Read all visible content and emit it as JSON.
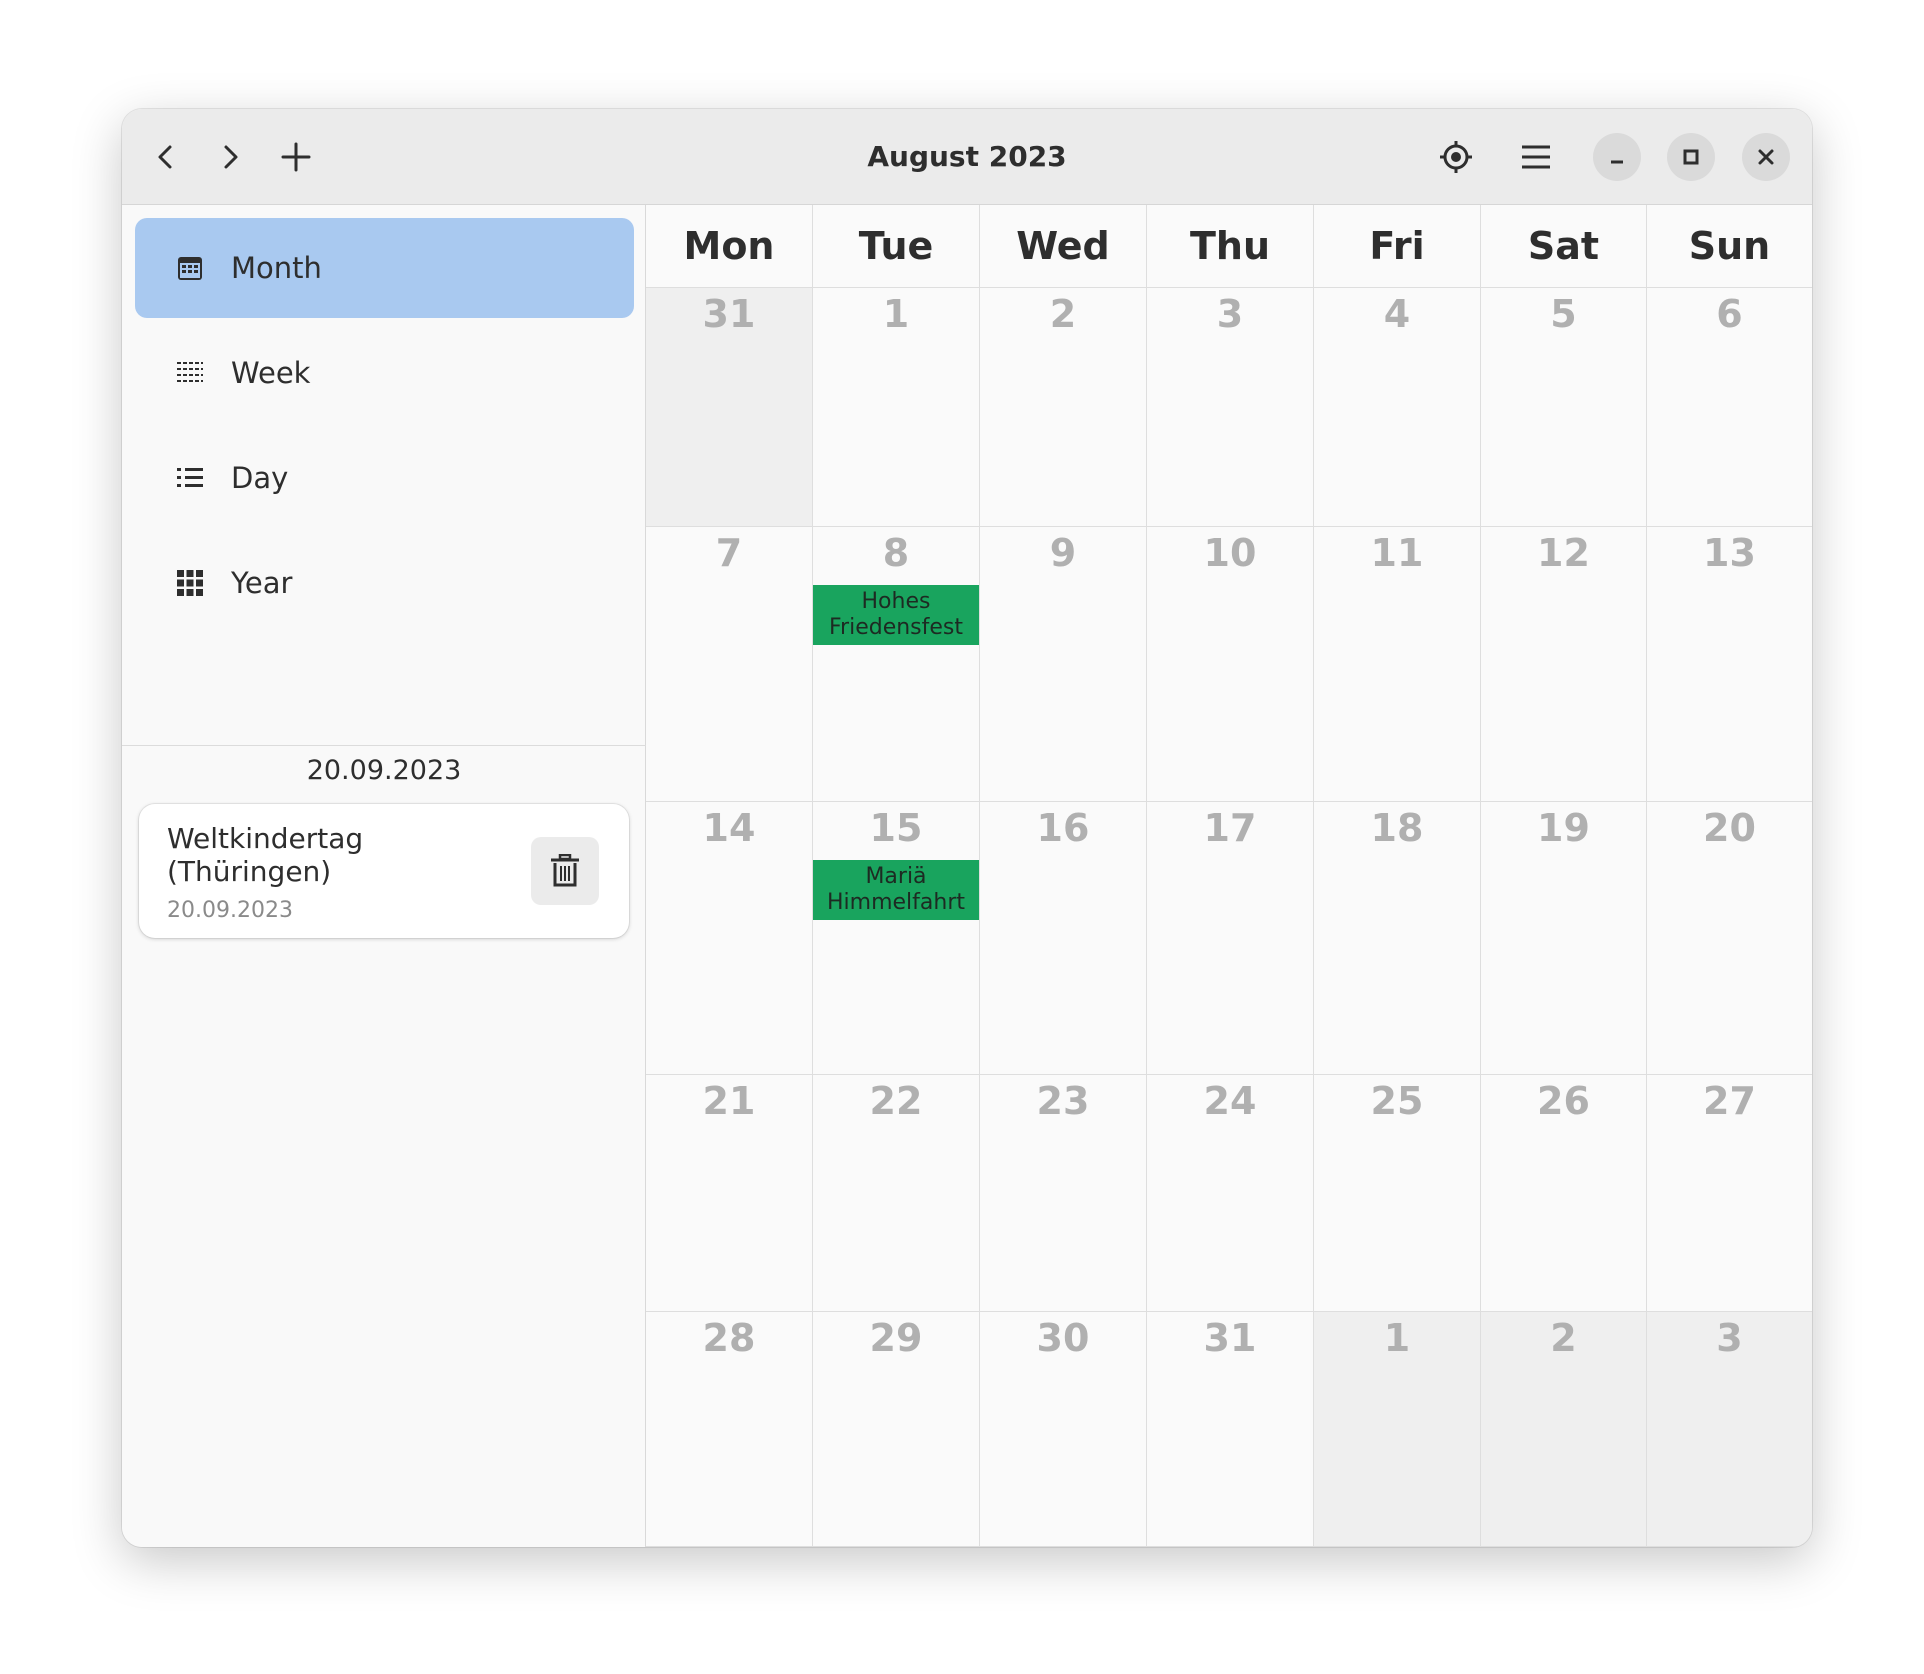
{
  "window": {
    "title": "August 2023",
    "header_buttons": [
      "chevron-left-icon",
      "chevron-right-icon",
      "plus-icon",
      "target-icon",
      "hamburger-menu-icon",
      "minimize-icon",
      "maximize-icon",
      "close-icon"
    ]
  },
  "sidebar": {
    "items": [
      {
        "label": "Month",
        "icon": "calendar-month-icon",
        "active": true
      },
      {
        "label": "Week",
        "icon": "calendar-week-icon",
        "active": false
      },
      {
        "label": "Day",
        "icon": "list-icon",
        "active": false
      },
      {
        "label": "Year",
        "icon": "grid-icon",
        "active": false
      }
    ],
    "selected_date": "20.09.2023",
    "events": [
      {
        "title": "Weltkindertag (Thüringen)",
        "date": "20.09.2023",
        "delete_icon": "trash-icon"
      }
    ]
  },
  "calendar": {
    "weekdays": [
      "Mon",
      "Tue",
      "Wed",
      "Thu",
      "Fri",
      "Sat",
      "Sun"
    ],
    "weeks": [
      [
        {
          "day": "31",
          "other": true
        },
        {
          "day": "1"
        },
        {
          "day": "2"
        },
        {
          "day": "3"
        },
        {
          "day": "4"
        },
        {
          "day": "5"
        },
        {
          "day": "6"
        }
      ],
      [
        {
          "day": "7"
        },
        {
          "day": "8",
          "event": "Hohes Friedensfest"
        },
        {
          "day": "9"
        },
        {
          "day": "10"
        },
        {
          "day": "11"
        },
        {
          "day": "12"
        },
        {
          "day": "13"
        }
      ],
      [
        {
          "day": "14"
        },
        {
          "day": "15",
          "event": "Mariä Himmelfahrt"
        },
        {
          "day": "16"
        },
        {
          "day": "17"
        },
        {
          "day": "18"
        },
        {
          "day": "19"
        },
        {
          "day": "20"
        }
      ],
      [
        {
          "day": "21"
        },
        {
          "day": "22"
        },
        {
          "day": "23"
        },
        {
          "day": "24"
        },
        {
          "day": "25"
        },
        {
          "day": "26"
        },
        {
          "day": "27"
        }
      ],
      [
        {
          "day": "28"
        },
        {
          "day": "29"
        },
        {
          "day": "30"
        },
        {
          "day": "31"
        },
        {
          "day": "1",
          "other": true
        },
        {
          "day": "2",
          "other": true
        },
        {
          "day": "3",
          "other": true
        }
      ]
    ],
    "colors": {
      "event": "#19a45e",
      "selected_nav": "#a9c9f0",
      "other_month": "#efefef"
    }
  }
}
